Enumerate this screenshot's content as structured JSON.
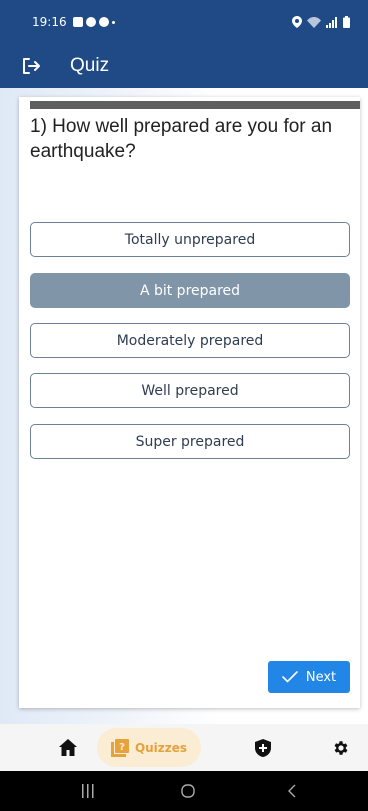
{
  "status_bar": {
    "time": "19:16"
  },
  "app_bar": {
    "title": "Quiz",
    "exit_icon": "logout-icon"
  },
  "quiz": {
    "question": "1) How well prepared are you for an earthquake?",
    "options": [
      {
        "label": "Totally unprepared",
        "selected": false
      },
      {
        "label": "A bit prepared",
        "selected": true
      },
      {
        "label": "Moderately prepared",
        "selected": false
      },
      {
        "label": "Well prepared",
        "selected": false
      },
      {
        "label": "Super prepared",
        "selected": false
      }
    ],
    "next_label": "Next"
  },
  "bottom_nav": {
    "items": [
      {
        "icon": "home-icon"
      },
      {
        "icon": "quiz-icon",
        "label": "Quizzes",
        "active": true
      },
      {
        "icon": "shield-icon"
      },
      {
        "icon": "gear-icon"
      }
    ]
  },
  "colors": {
    "primary": "#1f4a86",
    "accent": "#2286e6",
    "selected_option": "#8195a8",
    "active_nav": "#e6a23c"
  }
}
